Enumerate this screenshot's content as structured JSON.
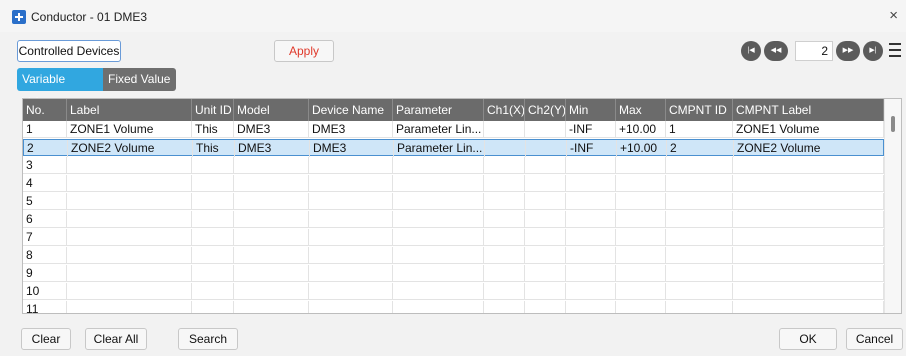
{
  "window": {
    "title": "Conductor - 01 DME3",
    "close_glyph": "×"
  },
  "toolbar": {
    "controlled_devices_label": "Controlled Devices",
    "apply_label": "Apply",
    "apply_color": "#e0392b"
  },
  "pager": {
    "first_glyph": "|◀",
    "prev_glyph": "◀◀",
    "page": "2",
    "next_glyph": "▶▶",
    "last_glyph": "▶|"
  },
  "tabs": {
    "variable": "Variable Value",
    "fixed": "Fixed Value",
    "active_color": "#31a7e0"
  },
  "table": {
    "headers": [
      "No.",
      "Label",
      "Unit ID",
      "Model",
      "Device Name",
      "Parameter",
      "Ch1(X)",
      "Ch2(Y)",
      "Min",
      "Max",
      "CMPNT ID",
      "CMPNT Label"
    ],
    "rows": [
      [
        "1",
        "ZONE1 Volume",
        "This",
        "DME3",
        "DME3",
        "Parameter Lin...",
        "",
        "",
        "-INF",
        "+10.00",
        "1",
        "ZONE1 Volume"
      ],
      [
        "2",
        "ZONE2 Volume",
        "This",
        "DME3",
        "DME3",
        "Parameter Lin...",
        "",
        "",
        "-INF",
        "+10.00",
        "2",
        "ZONE2 Volume"
      ],
      [
        "3",
        "",
        "",
        "",
        "",
        "",
        "",
        "",
        "",
        "",
        "",
        ""
      ],
      [
        "4",
        "",
        "",
        "",
        "",
        "",
        "",
        "",
        "",
        "",
        "",
        ""
      ],
      [
        "5",
        "",
        "",
        "",
        "",
        "",
        "",
        "",
        "",
        "",
        "",
        ""
      ],
      [
        "6",
        "",
        "",
        "",
        "",
        "",
        "",
        "",
        "",
        "",
        "",
        ""
      ],
      [
        "7",
        "",
        "",
        "",
        "",
        "",
        "",
        "",
        "",
        "",
        "",
        ""
      ],
      [
        "8",
        "",
        "",
        "",
        "",
        "",
        "",
        "",
        "",
        "",
        "",
        ""
      ],
      [
        "9",
        "",
        "",
        "",
        "",
        "",
        "",
        "",
        "",
        "",
        "",
        ""
      ],
      [
        "10",
        "",
        "",
        "",
        "",
        "",
        "",
        "",
        "",
        "",
        "",
        ""
      ],
      [
        "11",
        "",
        "",
        "",
        "",
        "",
        "",
        "",
        "",
        "",
        "",
        ""
      ]
    ],
    "selected_row": 2
  },
  "footer": {
    "clear": "Clear",
    "clear_all": "Clear All",
    "search": "Search",
    "ok": "OK",
    "cancel": "Cancel"
  }
}
